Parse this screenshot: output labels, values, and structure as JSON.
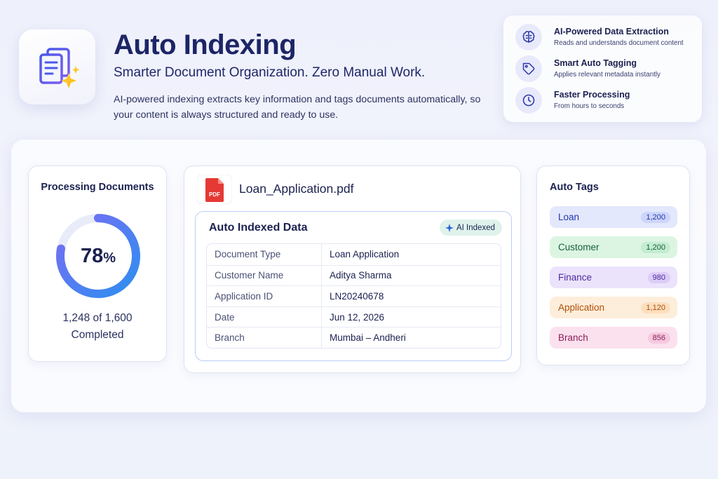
{
  "hero": {
    "title": "Auto Indexing",
    "subtitle": "Smarter Document Organization. Zero Manual Work.",
    "description": "AI-powered indexing extracts key information and tags documents automatically, so your content is always structured and ready to use."
  },
  "features": [
    {
      "title": "AI-Powered Data Extraction",
      "desc": "Reads and understands document content",
      "icon": "brain-icon"
    },
    {
      "title": "Smart Auto Tagging",
      "desc": "Applies relevant metadata instantly",
      "icon": "tag-icon"
    },
    {
      "title": "Faster Processing",
      "desc": "From hours to seconds",
      "icon": "clock-icon"
    }
  ],
  "processing": {
    "title": "Processing Documents",
    "percent": "78",
    "percent_unit": "%",
    "progress_fraction": 0.78,
    "count_text": "1,248 of 1,600",
    "status_text": "Completed"
  },
  "document": {
    "file_icon_label": "PDF",
    "filename": "Loan_Application.pdf",
    "section_title": "Auto Indexed Data",
    "badge": "AI Indexed",
    "fields": [
      {
        "key": "Document Type",
        "value": "Loan Application"
      },
      {
        "key": "Customer Name",
        "value": "Aditya Sharma"
      },
      {
        "key": "Application ID",
        "value": "LN20240678"
      },
      {
        "key": "Date",
        "value": "Jun 12, 2026"
      },
      {
        "key": "Branch",
        "value": "Mumbai – Andheri"
      }
    ]
  },
  "tags": {
    "title": "Auto Tags",
    "items": [
      {
        "label": "Loan",
        "count": "1,200",
        "bg": "#e3e8fc",
        "fg": "#2436a8",
        "badge_bg": "#cdd6fa"
      },
      {
        "label": "Customer",
        "count": "1,200",
        "bg": "#dcf5e3",
        "fg": "#17603a",
        "badge_bg": "#c3ecd0"
      },
      {
        "label": "Finance",
        "count": "980",
        "bg": "#ebe3fb",
        "fg": "#4b2a9c",
        "badge_bg": "#dccdf8"
      },
      {
        "label": "Application",
        "count": "1,120",
        "bg": "#fdeedb",
        "fg": "#b14e07",
        "badge_bg": "#fbdfbf"
      },
      {
        "label": "Branch",
        "count": "856",
        "bg": "#fbe1ee",
        "fg": "#8a1d5a",
        "badge_bg": "#f6c9df"
      }
    ]
  },
  "colors": {
    "accent": "#3a52e0",
    "progress_start": "#2d8ff0",
    "progress_end": "#7a6cf3",
    "pdf_red": "#e53935"
  }
}
